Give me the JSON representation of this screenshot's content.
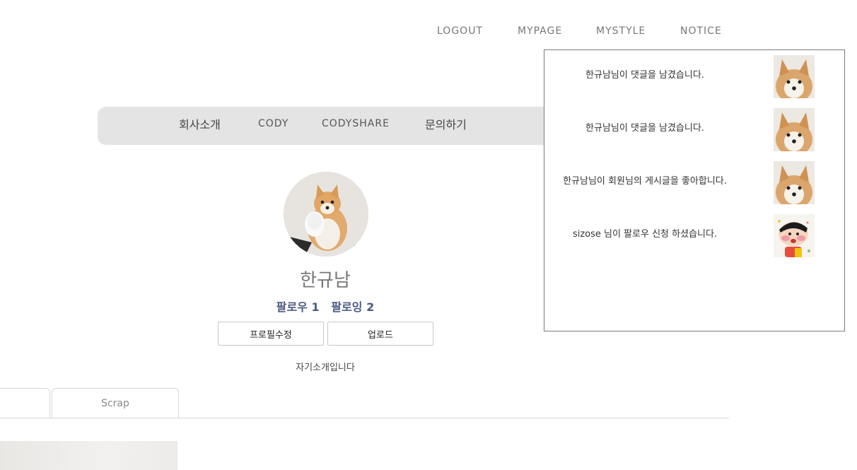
{
  "top_nav": {
    "logout": "LOGOUT",
    "mypage": "MYPAGE",
    "mystyle": "MYSTYLE",
    "notice": "NOTICE"
  },
  "main_nav": {
    "company": "회사소개",
    "cody": "CODY",
    "codyshare": "CODYSHARE",
    "inquiry": "문의하기"
  },
  "profile": {
    "username": "한규남",
    "follower_label": "팔로우",
    "follower_count": "1",
    "following_label": "팔로잉",
    "following_count": "2",
    "edit_button": "프로필수정",
    "upload_button": "업로드",
    "bio": "자기소개입니다"
  },
  "tabs": {
    "scrap": "Scrap"
  },
  "notifications": [
    {
      "text": "한규남님이 댓글을 남겼습니다.",
      "thumb": "dog-photo"
    },
    {
      "text": "한규남님이 댓글을 남겼습니다.",
      "thumb": "dog-photo"
    },
    {
      "text": "한규남님이 회원님의 게시글을 좋아합니다.",
      "thumb": "dog-photo"
    },
    {
      "text": "sizose 님이 팔로우 신청 하셨습니다.",
      "thumb": "cartoon-character"
    }
  ],
  "colors": {
    "nav_bg": "#e4e4e4",
    "follow_text": "#4a5a82",
    "panel_border": "#7a7a7a"
  }
}
